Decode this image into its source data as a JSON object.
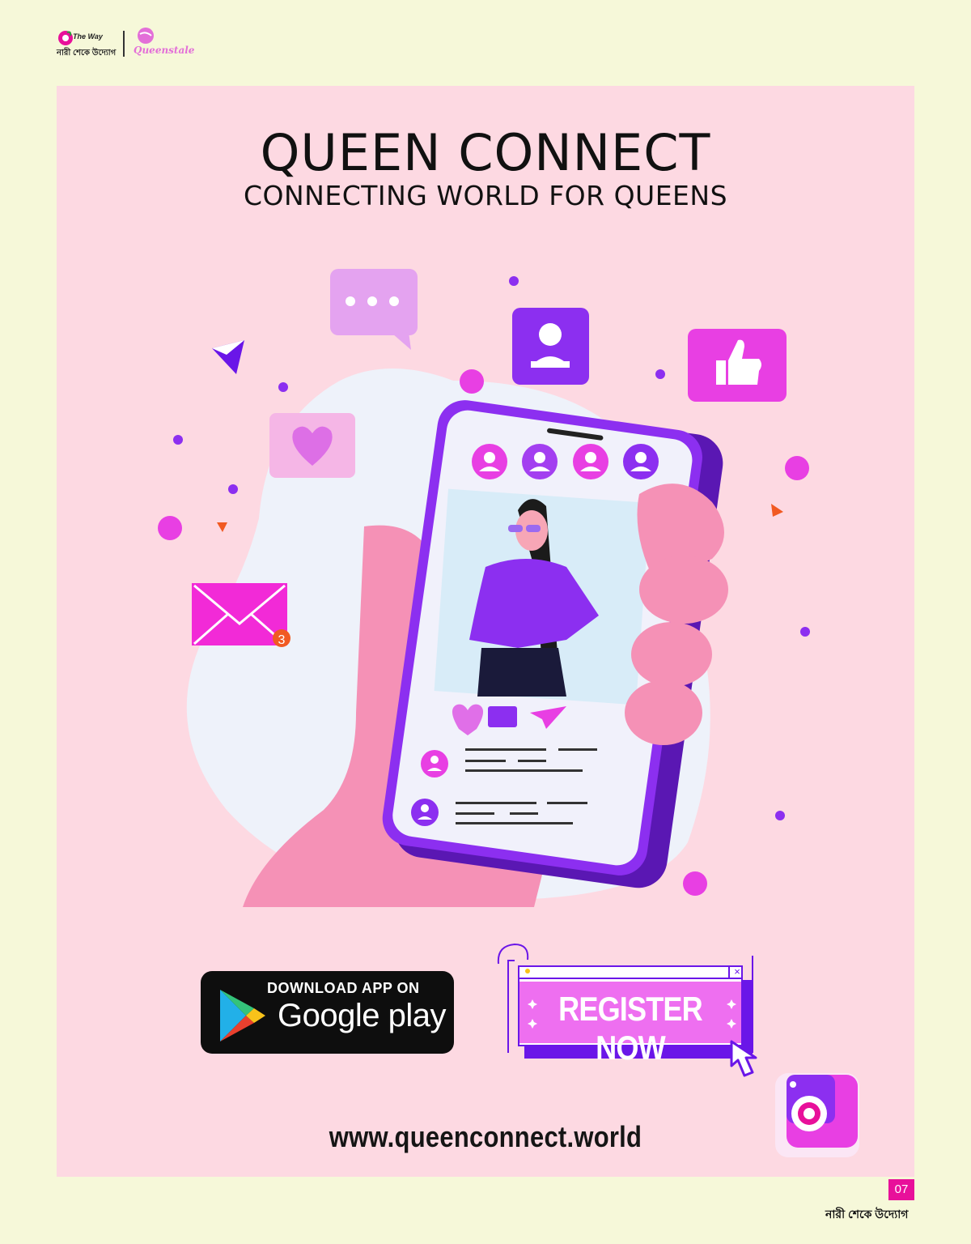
{
  "header": {
    "brand_left_line1": "The Way",
    "brand_left_line2": "নারী শেকে উদ্যোগ",
    "brand_right": "Queenstale"
  },
  "hero": {
    "title": "QUEEN CONNECT",
    "subtitle": "CONNECTING WORLD FOR QUEENS"
  },
  "illustration": {
    "mail_badge_count": "3"
  },
  "google_play": {
    "line1": "DOWNLOAD APP ON",
    "line2": "Google play",
    "tm": "™"
  },
  "register": {
    "label": "REGISTER NOW",
    "close_glyph": "×"
  },
  "website": "www.queenconnect.world",
  "footer": {
    "page_number": "07",
    "logo_text": "নারী শেকে উদ্যোগ"
  },
  "colors": {
    "page_bg": "#f6f8d9",
    "panel_bg": "#fdd9e2",
    "purple": "#8c2ff0",
    "magenta": "#e83fe3",
    "pink_hand": "#f591b6"
  }
}
